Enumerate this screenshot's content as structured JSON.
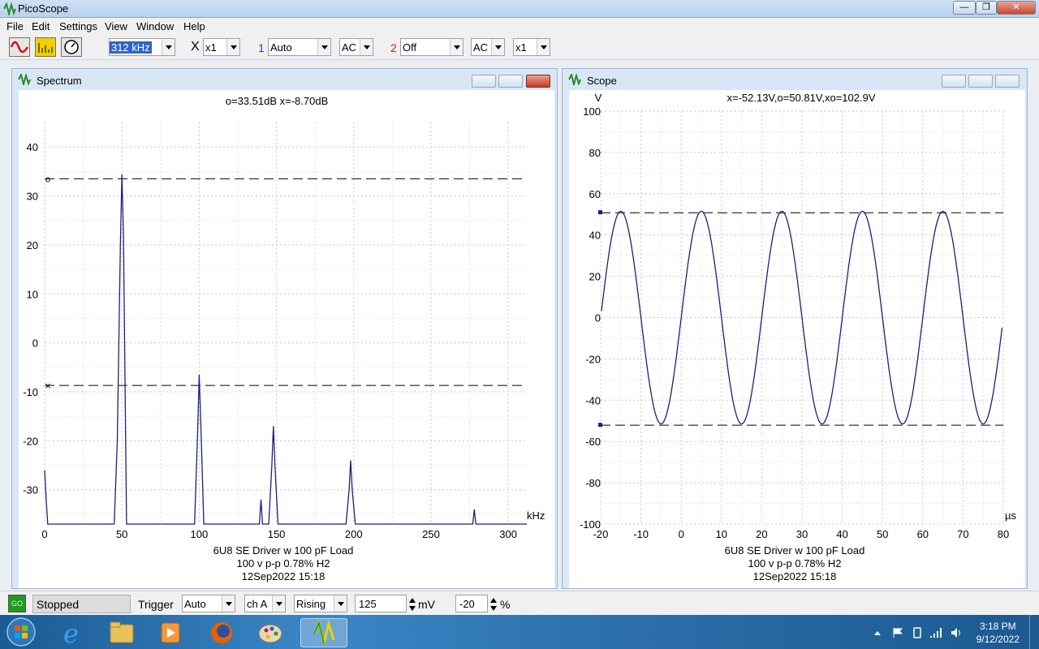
{
  "app": {
    "title": "PicoScope"
  },
  "menu": [
    "File",
    "Edit",
    "Settings",
    "View",
    "Window",
    "Help"
  ],
  "toolbar": {
    "timebase": "312 kHz",
    "x_multiplier_label": "X",
    "x_multiplier": "x1",
    "ch1_label": "1",
    "ch1_range": "Auto",
    "ch1_coupling": "AC",
    "ch2_label": "2",
    "ch2_range": "Off",
    "ch2_coupling": "AC",
    "ch2_multiplier": "x1"
  },
  "colors": {
    "trace": "#1f1f78",
    "ch1": "#1f3fbf",
    "ch2": "#d02020"
  },
  "spectrum": {
    "title": "Spectrum",
    "readout": "o=33.51dB  x=-8.70dB",
    "caption": [
      "6U8 SE Driver w 100 pF Load",
      "100 v p-p 0.78% H2",
      "12Sep2022  15:18"
    ],
    "xunit": "kHz",
    "xticks": [
      "0",
      "50",
      "100",
      "150",
      "200",
      "250",
      "300"
    ],
    "yticks": [
      "40",
      "30",
      "20",
      "10",
      "0",
      "-10",
      "-20",
      "-30"
    ],
    "cursor_o": "o",
    "cursor_x": "×"
  },
  "scope": {
    "title": "Scope",
    "readout": "x=-52.13V,o=50.81V,xo=102.9V",
    "caption": [
      "6U8 SE Driver w 100 pF Load",
      "100 v p-p 0.78% H2",
      "12Sep2022  15:18"
    ],
    "yunit": "V",
    "xunit": "µs",
    "xticks": [
      "-20",
      "-10",
      "0",
      "10",
      "20",
      "30",
      "40",
      "50",
      "60",
      "70",
      "80"
    ],
    "yticks": [
      "100",
      "80",
      "60",
      "40",
      "20",
      "0",
      "-20",
      "-40",
      "-60",
      "-80",
      "-100"
    ]
  },
  "status": {
    "go_label": "GO",
    "state": "Stopped",
    "trigger_label": "Trigger",
    "trigger_mode": "Auto",
    "trigger_channel": "ch A",
    "trigger_edge": "Rising",
    "trigger_level": "125",
    "level_unit": "mV",
    "pre_trigger": "-20",
    "pre_trigger_unit": "%"
  },
  "taskbar": {
    "time": "3:18 PM",
    "date": "9/12/2022"
  },
  "chart_data": [
    {
      "type": "line",
      "title": "Spectrum",
      "xlabel": "kHz",
      "ylabel": "",
      "xlim": [
        0,
        312
      ],
      "ylim": [
        -37,
        45
      ],
      "grid": true,
      "series": [
        {
          "x": [
            0,
            1,
            2,
            45,
            47,
            49,
            50,
            51,
            53,
            97,
            99,
            100,
            101,
            103,
            139,
            140,
            141,
            145,
            147,
            148,
            149,
            151,
            195,
            197,
            198,
            199,
            201,
            277,
            278,
            279,
            312
          ],
          "y": [
            -26,
            -32,
            -37,
            -37,
            -20,
            20,
            34.4,
            22,
            -37,
            -37,
            -18,
            -6.5,
            -16,
            -37,
            -37,
            -32,
            -37,
            -37,
            -25,
            -17,
            -25,
            -37,
            -37,
            -30,
            -24,
            -30,
            -37,
            -37,
            -34,
            -37,
            -37
          ]
        }
      ],
      "cursors": {
        "o_db": 33.51,
        "x_db": -8.7
      }
    },
    {
      "type": "line",
      "title": "Scope",
      "xlabel": "µs",
      "ylabel": "V",
      "xlim": [
        -20,
        80
      ],
      "ylim": [
        -100,
        100
      ],
      "grid": true,
      "waveform": {
        "shape": "sine",
        "amplitude": 51.5,
        "period_us": 20,
        "peak_at_us": 5
      },
      "cursors": {
        "o_v": 50.81,
        "x_v": -52.13
      }
    }
  ]
}
